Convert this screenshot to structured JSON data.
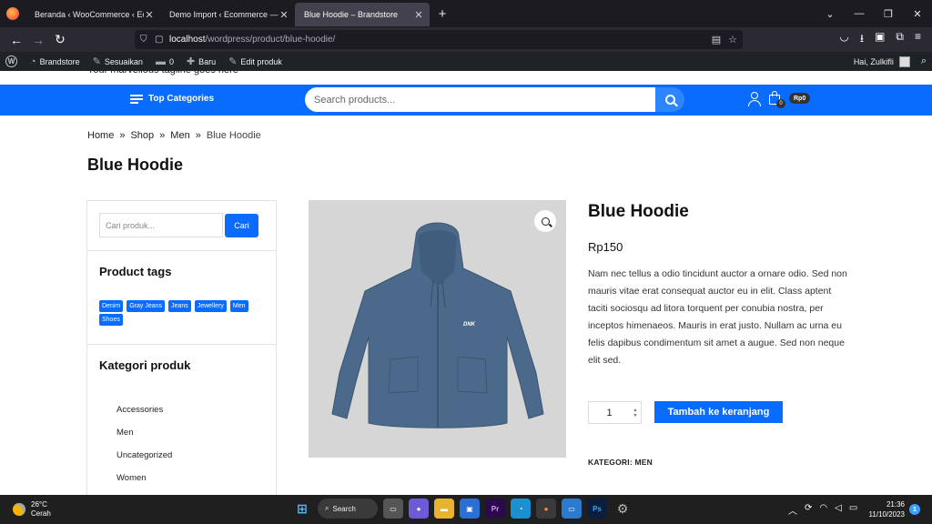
{
  "browser": {
    "tabs": [
      {
        "title": "Beranda ‹ WooCommerce ‹ Ecomm",
        "active": false
      },
      {
        "title": "Demo Import ‹ Ecommerce — Wor",
        "active": false
      },
      {
        "title": "Blue Hoodie – Brandstore",
        "active": true
      }
    ],
    "url_host": "localhost",
    "url_path": "/wordpress/product/blue-hoodie/"
  },
  "adminbar": {
    "site_name": "Brandstore",
    "customize": "Sesuaikan",
    "comments_count": "0",
    "new": "Baru",
    "edit": "Edit produk",
    "greeting": "Hai, Zulkifli"
  },
  "site": {
    "tagline": "Your marvellous tagline goes here",
    "top_categories": "Top Categories",
    "search_placeholder": "Search products...",
    "cart_count": "0",
    "cart_total": "Rp0"
  },
  "breadcrumb": [
    "Home",
    "Shop",
    "Men",
    "Blue Hoodie"
  ],
  "page_title": "Blue Hoodie",
  "sidebar": {
    "search_placeholder": "Cari produk...",
    "search_button": "Cari",
    "tags_heading": "Product tags",
    "tags": [
      "Denim",
      "Gray Jeans",
      "Jeans",
      "Jewellery",
      "Men",
      "Shoes"
    ],
    "cats_heading": "Kategori produk",
    "categories": [
      "Accessories",
      "Men",
      "Uncategorized",
      "Women"
    ]
  },
  "product": {
    "title": "Blue Hoodie",
    "price": "Rp150",
    "description": "Nam nec tellus a odio tincidunt auctor a ornare odio. Sed non mauris vitae erat consequat auctor eu in elit. Class aptent taciti sociosqu ad litora torquent per conubia nostra, per inceptos himenaeos. Mauris in erat justo. Nullam ac urna eu felis dapibus condimentum sit amet a augue. Sed non neque elit sed.",
    "quantity": "1",
    "add_to_cart": "Tambah ke keranjang",
    "category_label": "KATEGORI:",
    "category_value": "MEN",
    "logo_text": "DNK"
  },
  "taskbar": {
    "temperature": "26°C",
    "weather": "Cerah",
    "search_label": "Search",
    "time": "21:36",
    "date": "11/10/2023",
    "notif_count": "1"
  },
  "colors": {
    "primary": "#0a6cff",
    "hoodie": "#4a6a8c"
  }
}
